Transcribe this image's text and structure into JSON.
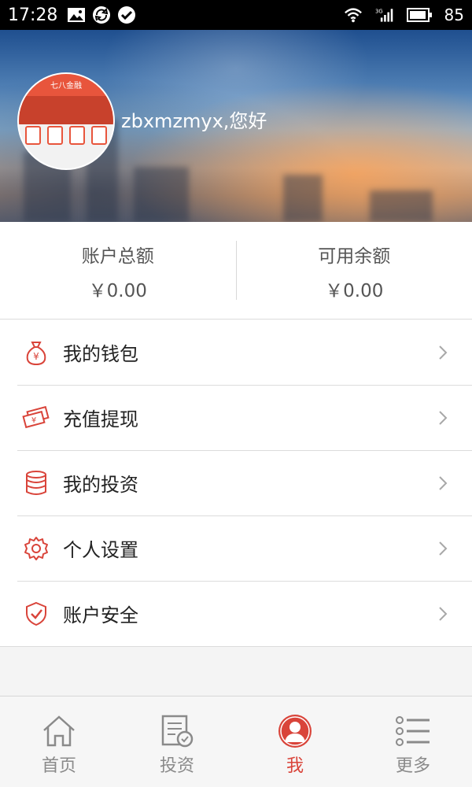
{
  "status_bar": {
    "time": "17:28",
    "battery": "85",
    "icons": [
      "image-icon",
      "sync-icon",
      "check-circle-icon",
      "wifi-icon",
      "signal-3g-icon",
      "battery-icon"
    ]
  },
  "header": {
    "greeting": "zbxmzmyx,您好",
    "avatar_title": "七八金融"
  },
  "balance": {
    "total_label": "账户总额",
    "total_value": "￥0.00",
    "available_label": "可用余额",
    "available_value": "￥0.00"
  },
  "menu": {
    "items": [
      {
        "label": "我的钱包",
        "icon": "money-bag-icon"
      },
      {
        "label": "充值提现",
        "icon": "banknotes-icon"
      },
      {
        "label": "我的投资",
        "icon": "database-icon"
      },
      {
        "label": "个人设置",
        "icon": "gear-icon"
      },
      {
        "label": "账户安全",
        "icon": "shield-check-icon"
      }
    ]
  },
  "tabbar": {
    "tabs": [
      {
        "label": "首页",
        "icon": "home-icon",
        "active": false
      },
      {
        "label": "投资",
        "icon": "document-check-icon",
        "active": false
      },
      {
        "label": "我",
        "icon": "user-icon",
        "active": true
      },
      {
        "label": "更多",
        "icon": "list-icon",
        "active": false
      }
    ]
  },
  "colors": {
    "accent": "#d9443a",
    "status_bar": "#000000",
    "text_primary": "#222222",
    "text_secondary": "#555555",
    "tab_inactive": "#8a8a8a"
  }
}
